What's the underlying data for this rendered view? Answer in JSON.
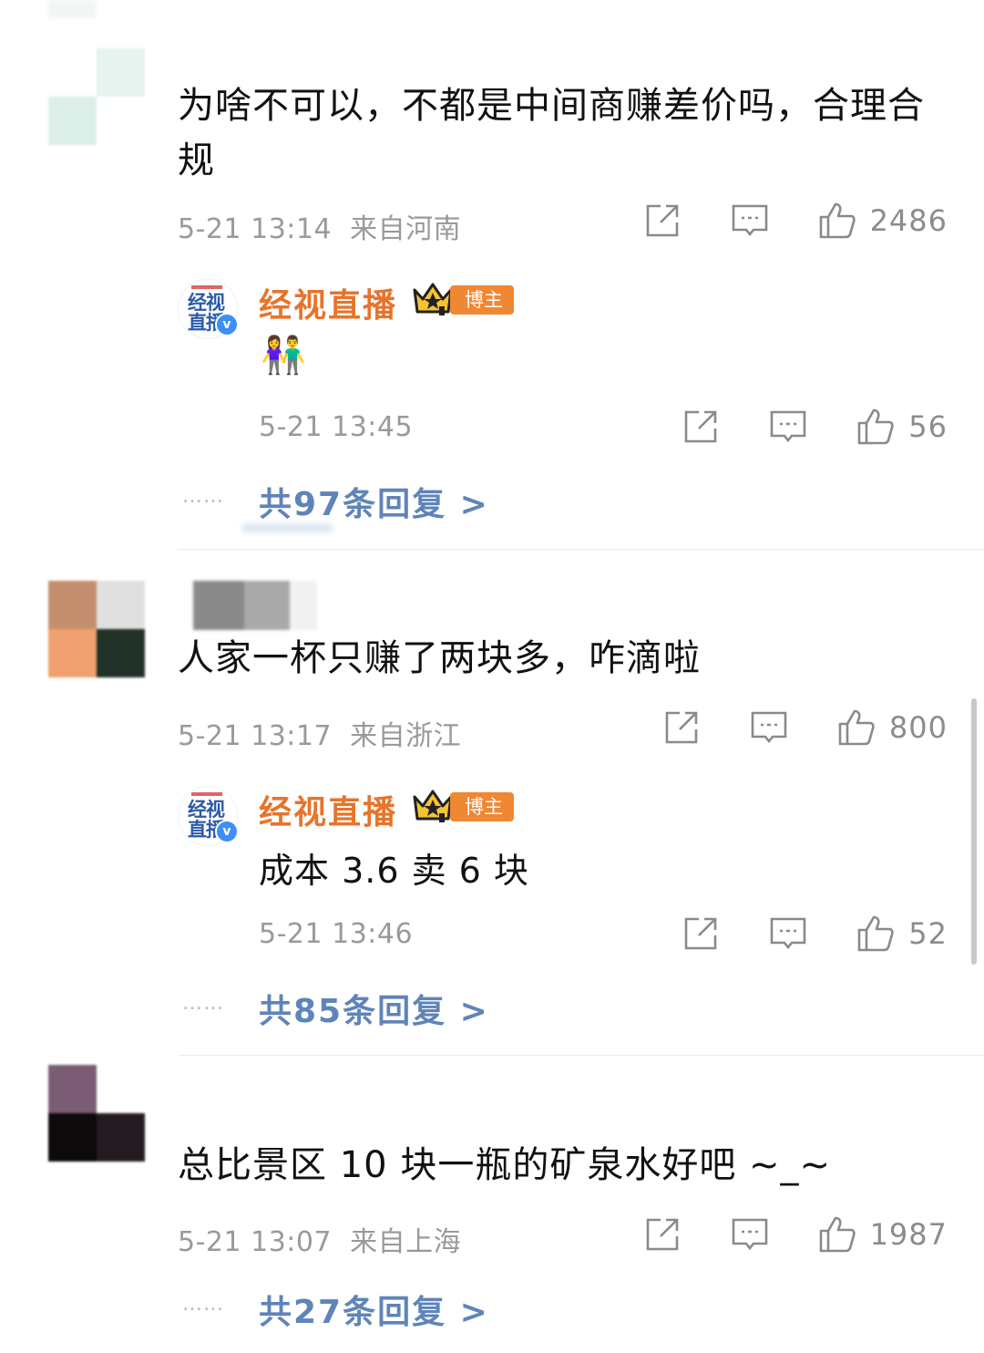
{
  "comments": [
    {
      "text": "为啥不可以，不都是中间商赚差价吗，合理合规",
      "text_line1": "为啥不可以，不都是中间商赚差价吗，合理合",
      "text_line2": "规",
      "time": "5-21 13:14",
      "location": "来自河南",
      "likes": "2486",
      "reply": {
        "author": "经视直播",
        "badge": "博主",
        "avatar_text": [
          "经视",
          "直播"
        ],
        "content_emoji": "👫",
        "time": "5-21 13:45",
        "likes": "56"
      },
      "replies_link": "共97条回复 >"
    },
    {
      "text": "人家一杯只赚了两块多，咋滴啦",
      "time": "5-21 13:17",
      "location": "来自浙江",
      "likes": "800",
      "reply": {
        "author": "经视直播",
        "badge": "博主",
        "avatar_text": [
          "经视",
          "直播"
        ],
        "content": "成本 3.6 卖 6 块",
        "time": "5-21 13:46",
        "likes": "52"
      },
      "replies_link": "共85条回复 >"
    },
    {
      "text": "总比景区 10 块一瓶的矿泉水好吧 ~_~",
      "time": "5-21 13:07",
      "location": "来自上海",
      "likes": "1987",
      "replies_link": "共27条回复 >"
    }
  ],
  "dots": "……",
  "icons": {
    "share": "share-icon",
    "comment": "comment-icon",
    "like": "thumbs-up-icon",
    "crown": "crown-icon",
    "verified": "verified-icon"
  },
  "colors": {
    "name_orange": "#e7742b",
    "badge_orange": "#f08733",
    "link_blue": "#5f84b8",
    "meta_gray": "#9a9a9a"
  }
}
